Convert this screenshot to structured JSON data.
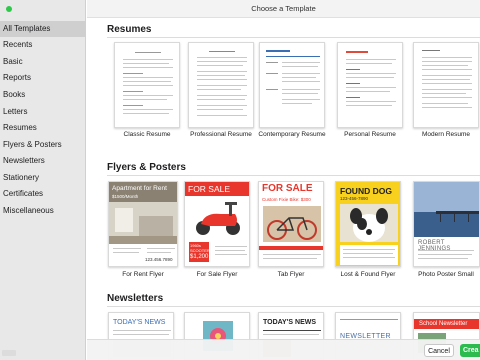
{
  "window": {
    "title": "Choose a Template"
  },
  "sidebar": {
    "items": [
      {
        "label": "All Templates",
        "selected": true
      },
      {
        "label": "Recents"
      },
      {
        "label": "Basic"
      },
      {
        "label": "Reports"
      },
      {
        "label": "Books"
      },
      {
        "label": "Letters"
      },
      {
        "label": "Resumes"
      },
      {
        "label": "Flyers & Posters"
      },
      {
        "label": "Newsletters"
      },
      {
        "label": "Stationery"
      },
      {
        "label": "Certificates"
      },
      {
        "label": "Miscellaneous"
      }
    ]
  },
  "sections": {
    "resumes": {
      "title": "Resumes",
      "items": [
        {
          "label": "Classic Resume"
        },
        {
          "label": "Professional Resume"
        },
        {
          "label": "Contemporary Resume"
        },
        {
          "label": "Personal Resume"
        },
        {
          "label": "Modern Resume"
        }
      ]
    },
    "flyers": {
      "title": "Flyers & Posters",
      "items": [
        {
          "label": "For Rent Flyer",
          "headline": "Apartment for Rent",
          "price": "$1500/Month",
          "phone": "123.456.7890"
        },
        {
          "label": "For Sale Flyer",
          "headline": "FOR SALE",
          "detail": "1960s SCOOTER",
          "price": "$1,200"
        },
        {
          "label": "Tab Flyer",
          "headline": "FOR SALE",
          "subhead": "Custom Fixie Bike: $300"
        },
        {
          "label": "Lost & Found Flyer",
          "headline": "FOUND DOG",
          "phone": "123-456-7890"
        },
        {
          "label": "Photo Poster Small",
          "name": "ROBERT JENNINGS"
        }
      ]
    },
    "newsletters": {
      "title": "Newsletters",
      "items": [
        {
          "headline": "TODAY'S NEWS"
        },
        {
          "headline": ""
        },
        {
          "headline": "TODAY'S NEWS"
        },
        {
          "headline": "NEWSLETTER"
        },
        {
          "headline": "School Newsletter"
        }
      ]
    }
  },
  "footer": {
    "cancel_label": "Cancel",
    "create_label": "Crea"
  },
  "colors": {
    "accent_green": "#2dbb4f",
    "sidebar_bg": "#e8e8e8",
    "selection": "#cfcfcf",
    "sale_red": "#e8362c",
    "found_yellow": "#f7d11e"
  }
}
